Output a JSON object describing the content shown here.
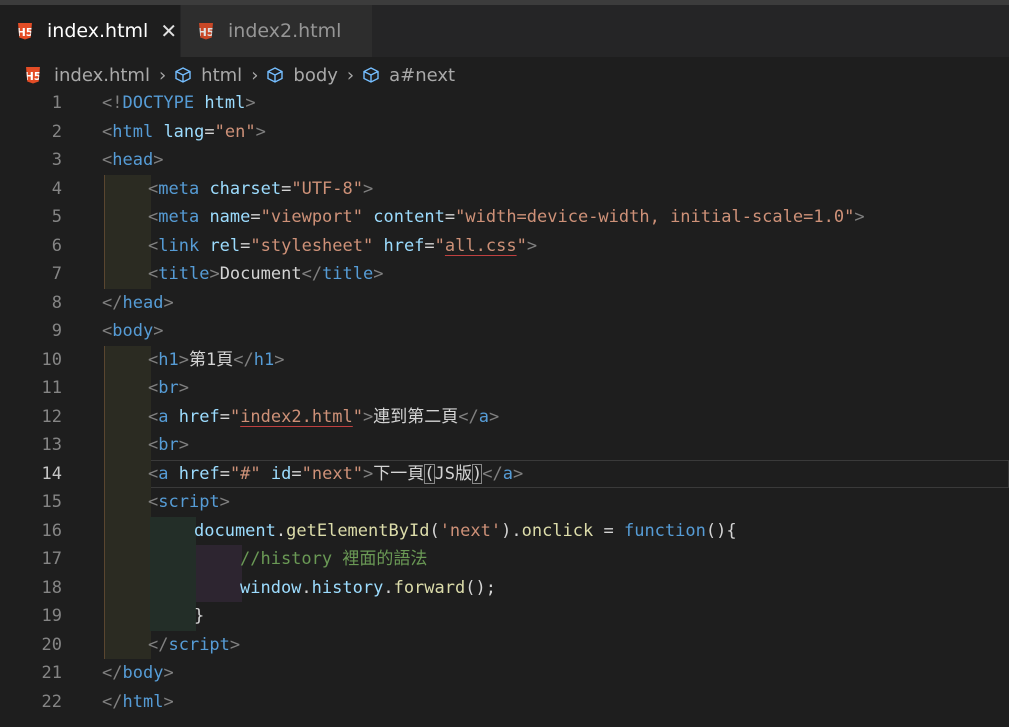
{
  "tabs": [
    {
      "label": "index.html",
      "active": true
    },
    {
      "label": "index2.html",
      "active": false
    }
  ],
  "icons": {
    "html5": "H5",
    "close": "✕"
  },
  "breadcrumb": {
    "file": "index.html",
    "items": [
      "html",
      "body",
      "a#next"
    ],
    "separator": "›"
  },
  "lines": [
    {
      "n": "1"
    },
    {
      "n": "2"
    },
    {
      "n": "3"
    },
    {
      "n": "4"
    },
    {
      "n": "5"
    },
    {
      "n": "6"
    },
    {
      "n": "7"
    },
    {
      "n": "8"
    },
    {
      "n": "9"
    },
    {
      "n": "10"
    },
    {
      "n": "11"
    },
    {
      "n": "12"
    },
    {
      "n": "13"
    },
    {
      "n": "14"
    },
    {
      "n": "15"
    },
    {
      "n": "16"
    },
    {
      "n": "17"
    },
    {
      "n": "18"
    },
    {
      "n": "19"
    },
    {
      "n": "20"
    },
    {
      "n": "21"
    },
    {
      "n": "22"
    }
  ],
  "code": {
    "l1": {
      "a": "<!",
      "b": "DOCTYPE",
      "c": " html",
      "d": ">"
    },
    "l2": {
      "a": "<",
      "b": "html",
      "c": " lang",
      "d": "=",
      "e": "\"en\"",
      "f": ">"
    },
    "l3": {
      "a": "<",
      "b": "head",
      "c": ">"
    },
    "l4": {
      "a": "<",
      "b": "meta",
      "c": " charset",
      "d": "=",
      "e": "\"UTF-8\"",
      "f": ">"
    },
    "l5": {
      "a": "<",
      "b": "meta",
      "c": " name",
      "d": "=",
      "e": "\"viewport\"",
      "f": " content",
      "g": "=",
      "h": "\"width=device-width, initial-scale=1.0\"",
      "i": ">"
    },
    "l6": {
      "a": "<",
      "b": "link",
      "c": " rel",
      "d": "=",
      "e": "\"stylesheet\"",
      "f": " href",
      "g": "=",
      "h1": "\"",
      "h2": "all.css",
      "h3": "\"",
      "i": ">"
    },
    "l7": {
      "a": "<",
      "b": "title",
      "c": ">",
      "d": "Document",
      "e": "</",
      "f": "title",
      "g": ">"
    },
    "l8": {
      "a": "</",
      "b": "head",
      "c": ">"
    },
    "l9": {
      "a": "<",
      "b": "body",
      "c": ">"
    },
    "l10": {
      "a": "<",
      "b": "h1",
      "c": ">",
      "d": "第1頁",
      "e": "</",
      "f": "h1",
      "g": ">"
    },
    "l11": {
      "a": "<",
      "b": "br",
      "c": ">"
    },
    "l12": {
      "a": "<",
      "b": "a",
      "c": " href",
      "d": "=",
      "e1": "\"",
      "e2": "index2.html",
      "e3": "\"",
      "f": ">",
      "g": "連到第二頁",
      "h": "</",
      "i": "a",
      "j": ">"
    },
    "l13": {
      "a": "<",
      "b": "br",
      "c": ">"
    },
    "l14": {
      "a": "<",
      "b": "a",
      "c": " href",
      "d": "=",
      "e": "\"#\"",
      "f": " id",
      "g": "=",
      "h": "\"next\"",
      "i": ">",
      "j": "下一頁",
      "k": "(",
      "l": "JS版",
      "m": ")",
      "n": "</",
      "o": "a",
      "p": ">"
    },
    "l15": {
      "a": "<",
      "b": "script",
      "c": ">"
    },
    "l16": {
      "a": "document",
      "b": ".",
      "c": "getElementById",
      "d": "(",
      "e": "'next'",
      "f": ").",
      "g": "onclick",
      "h": " = ",
      "i": "function",
      "j": "(){"
    },
    "l17": {
      "a": "//history 裡面的語法"
    },
    "l18": {
      "a": "window",
      "b": ".",
      "c": "history",
      "d": ".",
      "e": "forward",
      "f": "();"
    },
    "l19": {
      "a": "}"
    },
    "l20": {
      "a": "</",
      "b": "script",
      "c": ">"
    },
    "l21": {
      "a": "</",
      "b": "body",
      "c": ">"
    },
    "l22": {
      "a": "</",
      "b": "html",
      "c": ">"
    }
  }
}
